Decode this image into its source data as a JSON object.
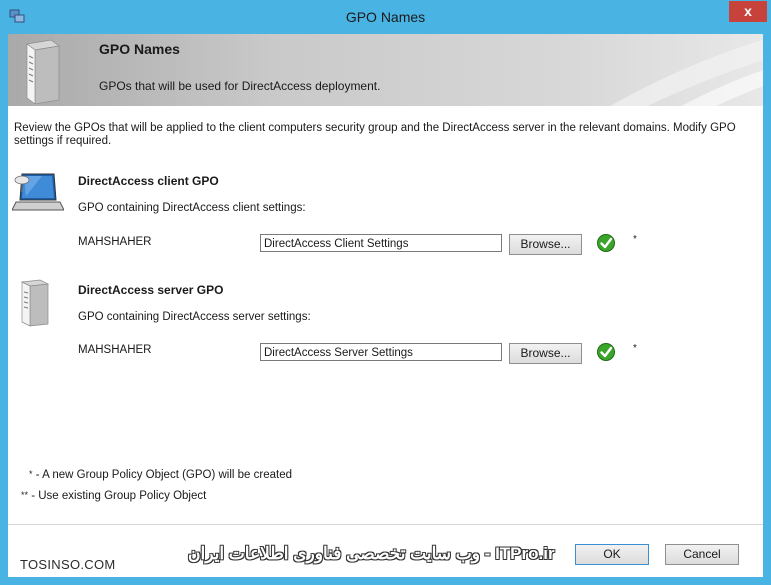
{
  "window": {
    "title": "GPO Names",
    "close_glyph": "x"
  },
  "header": {
    "title": "GPO Names",
    "subtitle": "GPOs that will be used for DirectAccess deployment."
  },
  "intro": {
    "line1": "Review the GPOs that will be applied to the client computers security group and the DirectAccess server in the relevant domains. Modify GPO",
    "line2": "settings if required."
  },
  "client_gpo": {
    "heading": "DirectAccess client GPO",
    "description": "GPO containing DirectAccess client settings:",
    "domain": "MAHSHAHER",
    "value": "DirectAccess Client Settings",
    "browse_label": "Browse...",
    "marker": "*"
  },
  "server_gpo": {
    "heading": "DirectAccess server GPO",
    "description": "GPO containing DirectAccess server settings:",
    "domain": "MAHSHAHER",
    "value": "DirectAccess Server Settings",
    "browse_label": "Browse...",
    "marker": "*"
  },
  "legend": {
    "new_marker": "*",
    "new_text": " - A new Group Policy Object (GPO) will be created",
    "existing_marker": "**",
    "existing_text": " - Use existing Group Policy Object"
  },
  "footer": {
    "ok_label": "OK",
    "cancel_label": "Cancel",
    "watermark_left": "TOSINSO.COM",
    "watermark_fa": "ITPro.ir - وب سایت تخصصی فناوری اطلاعات ایران"
  },
  "colors": {
    "frame": "#49b4e4",
    "close": "#c7423a",
    "check": "#3aa52a"
  }
}
